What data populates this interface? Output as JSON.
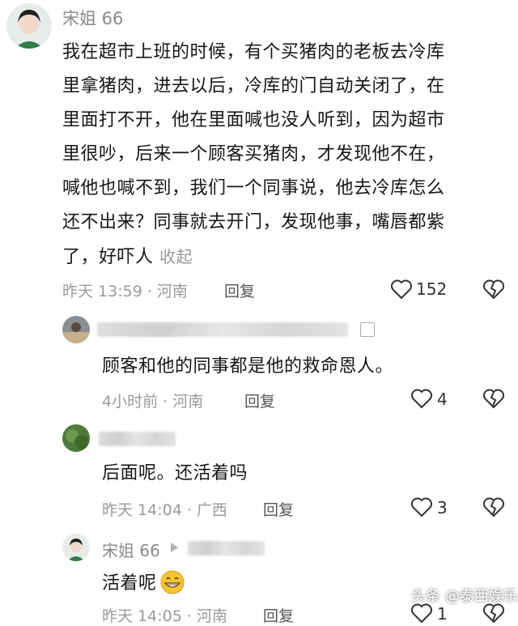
{
  "comments": [
    {
      "username": "宋姐 66",
      "lines": [
        "我在超市上班的时候，有个买猪肉的老板去冷库",
        "里拿猪肉，进去以后，冷库的门自动关闭了，在",
        "里面打不开，他在里面喊也没人听到，因为超市",
        "里很吵，后来一个顾客买猪肉，才发现他不在，",
        "喊他也喊不到，我们一个同事说，他去冷库怎么",
        "还不出来？同事就去开门，发现他事，嘴唇都紫",
        "了，好吓人"
      ],
      "collapse": "收起",
      "time_location": "昨天 13:59 · 河南",
      "reply": "回复",
      "likes": "152"
    }
  ],
  "replies": [
    {
      "text": "顾客和他的同事都是他的救命恩人。",
      "time_location": "4小时前 · 河南",
      "reply": "回复",
      "likes": "4"
    },
    {
      "text": "后面呢。还活着吗",
      "time_location": "昨天 14:04 · 广西",
      "reply": "回复",
      "likes": "3"
    },
    {
      "username": "宋姐 66",
      "text": "活着呢",
      "emoji": "grinning-face",
      "time_location": "昨天 14:05 · 河南",
      "reply": "回复",
      "likes": "1"
    }
  ],
  "icons": {
    "like": "heart-outline-icon",
    "dislike": "broken-heart-icon"
  },
  "watermark": "头条 @泰西娱乐"
}
